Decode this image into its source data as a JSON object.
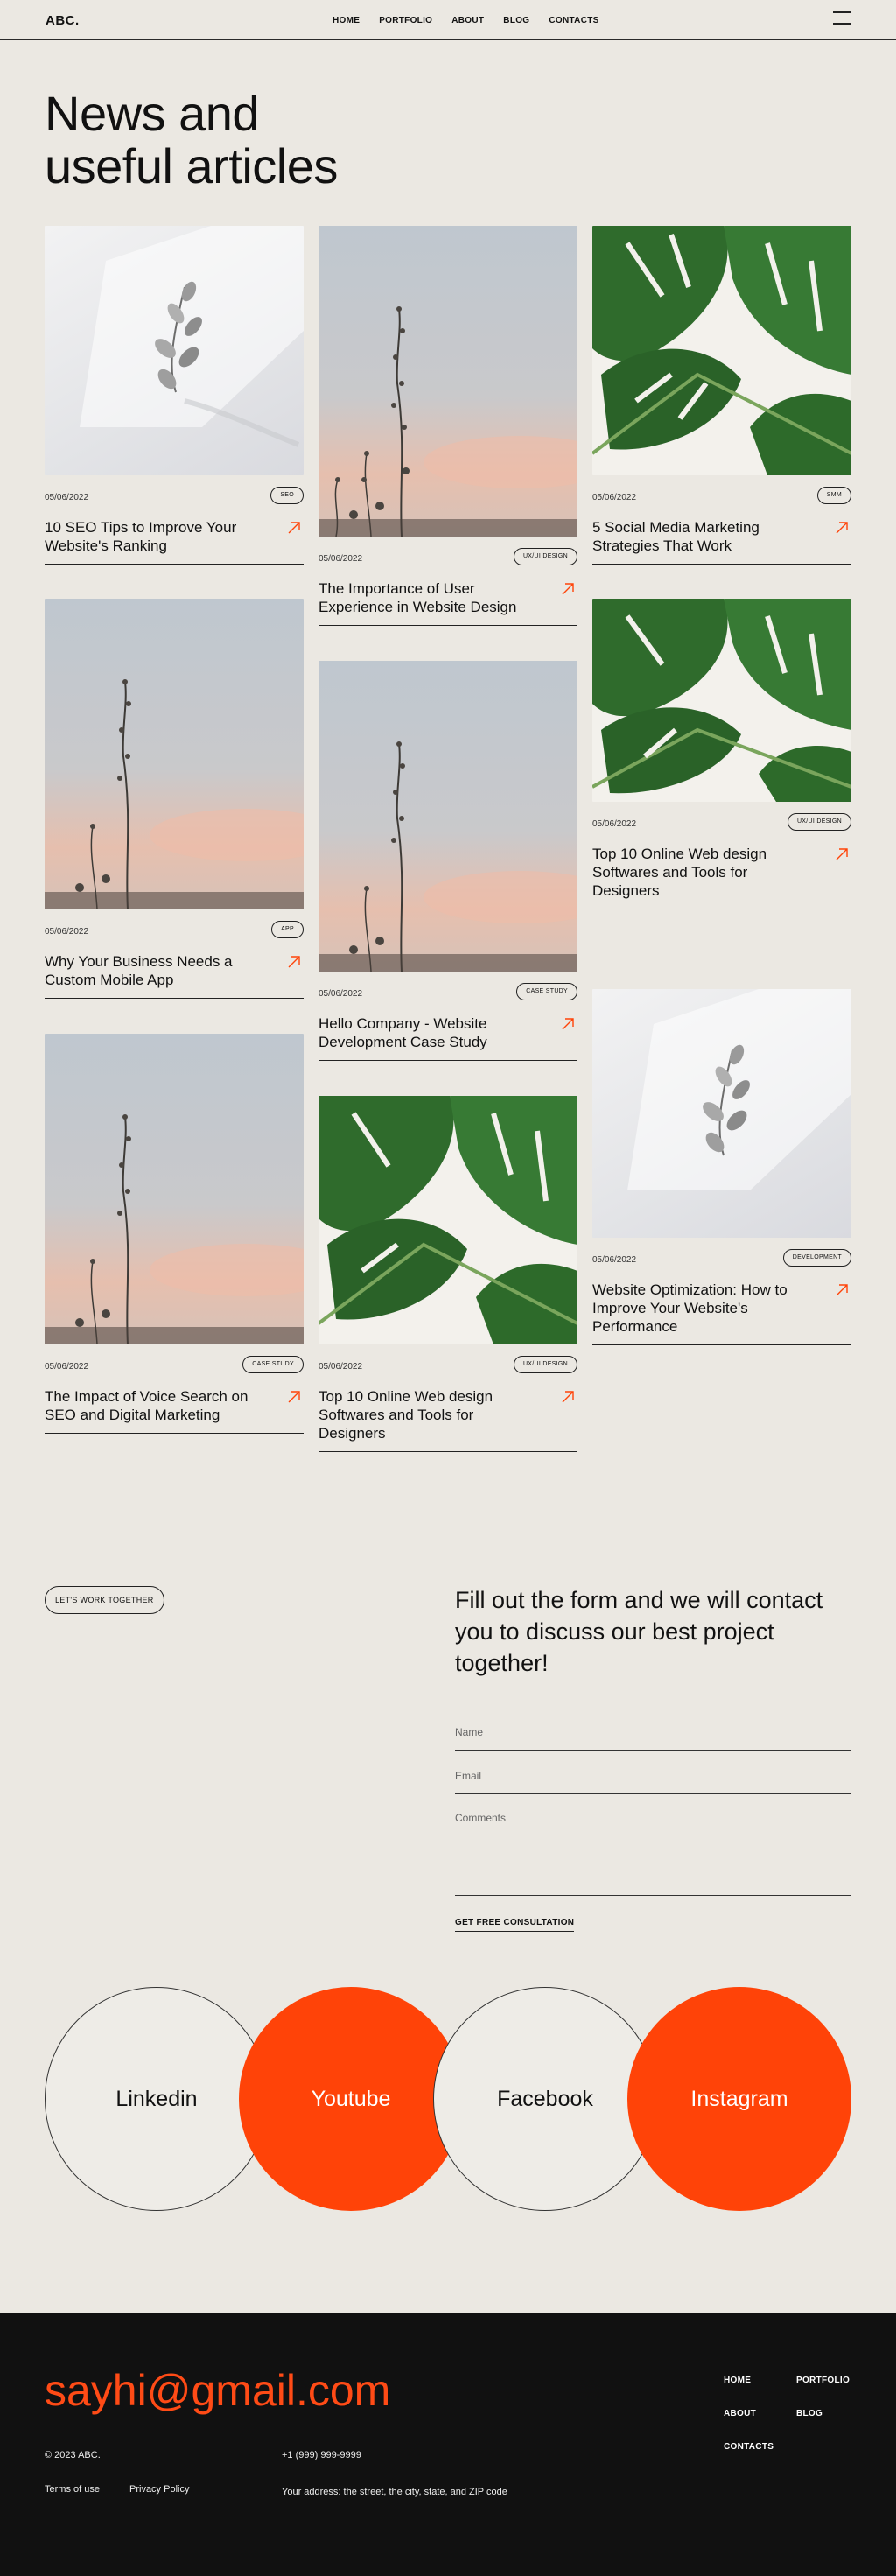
{
  "header": {
    "logo": "ABC.",
    "nav": [
      "HOME",
      "PORTFOLIO",
      "ABOUT",
      "BLOG",
      "CONTACTS"
    ]
  },
  "page_title_line1": "News and",
  "page_title_line2": "useful articles",
  "articles": [
    {
      "date": "05/06/2022",
      "tag": "SEO",
      "title": "10 SEO Tips to Improve Your Website's Ranking",
      "image": "plant-shadow"
    },
    {
      "date": "05/06/2022",
      "tag": "UX/UI DESIGN",
      "title": "The Importance of User Experience in Website Design",
      "image": "sky-branches"
    },
    {
      "date": "05/06/2022",
      "tag": "SMM",
      "title": "5 Social Media Marketing Strategies That Work",
      "image": "monstera"
    },
    {
      "date": "05/06/2022",
      "tag": "APP",
      "title": "Why Your Business Needs a Custom Mobile App",
      "image": "sky-branches"
    },
    {
      "date": "05/06/2022",
      "tag": "CASE STUDY",
      "title": "Hello Company - Website Development Case Study",
      "image": "sky-branches"
    },
    {
      "date": "05/06/2022",
      "tag": "UX/UI DESIGN",
      "title": "Top 10 Online Web design Softwares and Tools for Designers",
      "image": "monstera"
    },
    {
      "date": "05/06/2022",
      "tag": "CASE STUDY",
      "title": "The Impact of Voice Search on SEO and Digital Marketing",
      "image": "sky-branches"
    },
    {
      "date": "05/06/2022",
      "tag": "UX/UI DESIGN",
      "title": "Top 10 Online Web design Softwares and Tools for Designers",
      "image": "monstera"
    },
    {
      "date": "05/06/2022",
      "tag": "DEVELOPMENT",
      "title": "Website Optimization: How to Improve Your Website's Performance",
      "image": "plant-shadow"
    }
  ],
  "contact": {
    "cta_label": "LET'S WORK TOGETHER",
    "heading": "Fill out the form and we will contact you to discuss our best project together!",
    "name_placeholder": "Name",
    "email_placeholder": "Email",
    "comments_placeholder": "Comments",
    "submit_label": "GET FREE CONSULTATION"
  },
  "socials": [
    "Linkedin",
    "Youtube",
    "Facebook",
    "Instagram"
  ],
  "footer": {
    "email": "sayhi@gmail.com",
    "copyright": "© 2023 ABC.",
    "phone": "+1 (999) 999-9999",
    "terms": "Terms of use",
    "privacy": "Privacy Policy",
    "address": "Your address: the street, the city, state, and ZIP code",
    "nav": [
      "HOME",
      "PORTFOLIO",
      "ABOUT",
      "BLOG",
      "CONTACTS"
    ]
  },
  "colors": {
    "background": "#ebe8e2",
    "accent": "#ff4308",
    "footer_bg": "#111111"
  }
}
